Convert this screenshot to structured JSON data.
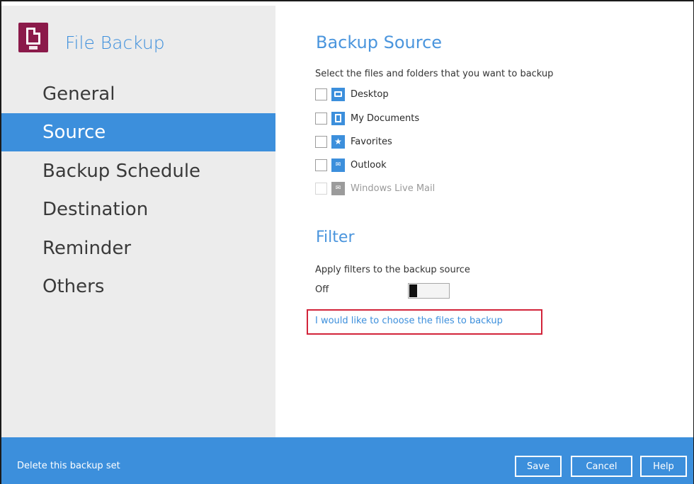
{
  "app": {
    "title": "File Backup",
    "logo_icon": "file-document-icon",
    "logo_color": "#8b1a4a"
  },
  "sidebar": {
    "items": [
      {
        "label": "General",
        "active": false
      },
      {
        "label": "Source",
        "active": true
      },
      {
        "label": "Backup Schedule",
        "active": false
      },
      {
        "label": "Destination",
        "active": false
      },
      {
        "label": "Reminder",
        "active": false
      },
      {
        "label": "Others",
        "active": false
      }
    ]
  },
  "backup_source": {
    "title": "Backup Source",
    "instruction": "Select the files and folders that you want to backup",
    "items": [
      {
        "label": "Desktop",
        "icon": "desktop-icon",
        "checked": false,
        "enabled": true
      },
      {
        "label": "My Documents",
        "icon": "document-icon",
        "checked": false,
        "enabled": true
      },
      {
        "label": "Favorites",
        "icon": "star-icon",
        "checked": false,
        "enabled": true
      },
      {
        "label": "Outlook",
        "icon": "outlook-icon",
        "checked": false,
        "enabled": true
      },
      {
        "label": "Windows Live Mail",
        "icon": "mail-icon",
        "checked": false,
        "enabled": false
      }
    ]
  },
  "filter": {
    "title": "Filter",
    "description": "Apply filters to the backup source",
    "toggle_state": "Off"
  },
  "choose_files_link": "I would like to choose the files to backup",
  "footer": {
    "delete_label": "Delete this backup set",
    "save_label": "Save",
    "cancel_label": "Cancel",
    "help_label": "Help"
  },
  "colors": {
    "accent": "#3c8fdc",
    "highlight_border": "#d2243a",
    "sidebar_bg": "#ececec"
  }
}
